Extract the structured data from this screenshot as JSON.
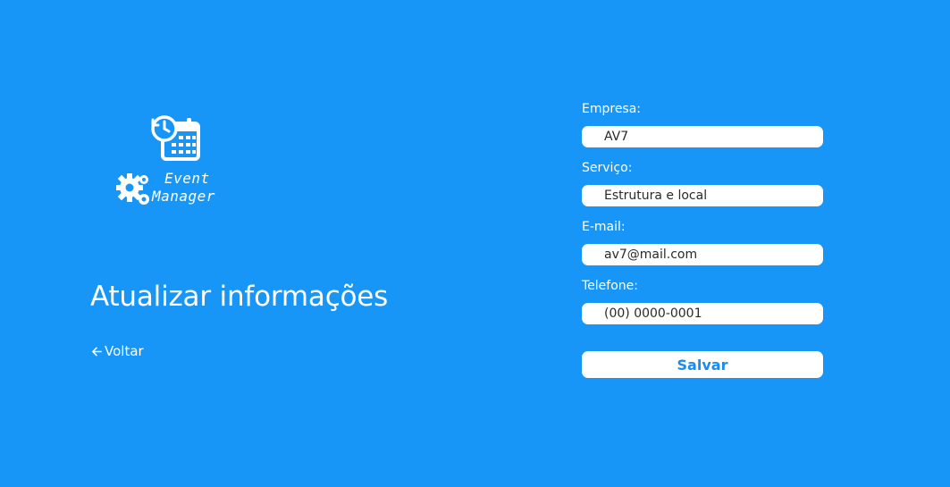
{
  "logo": {
    "line1": "Event",
    "line2": "Manager",
    "calendar_icon": "calendar-clock-icon",
    "gears_icon": "gears-icon"
  },
  "page_title": "Atualizar informações",
  "back_link": {
    "icon": "arrow-left-icon",
    "label": "Voltar"
  },
  "form": {
    "empresa": {
      "label": "Empresa:",
      "value": "AV7"
    },
    "servico": {
      "label": "Serviço:",
      "value": "Estrutura e local"
    },
    "email": {
      "label": "E-mail:",
      "value": "av7@mail.com"
    },
    "telefone": {
      "label": "Telefone:",
      "value": "(00) 0000-0001"
    },
    "save_label": "Salvar"
  },
  "colors": {
    "background": "#1796f7",
    "button_text": "#1a8cf0",
    "input_background": "#ffffff",
    "text": "#ffffff"
  }
}
